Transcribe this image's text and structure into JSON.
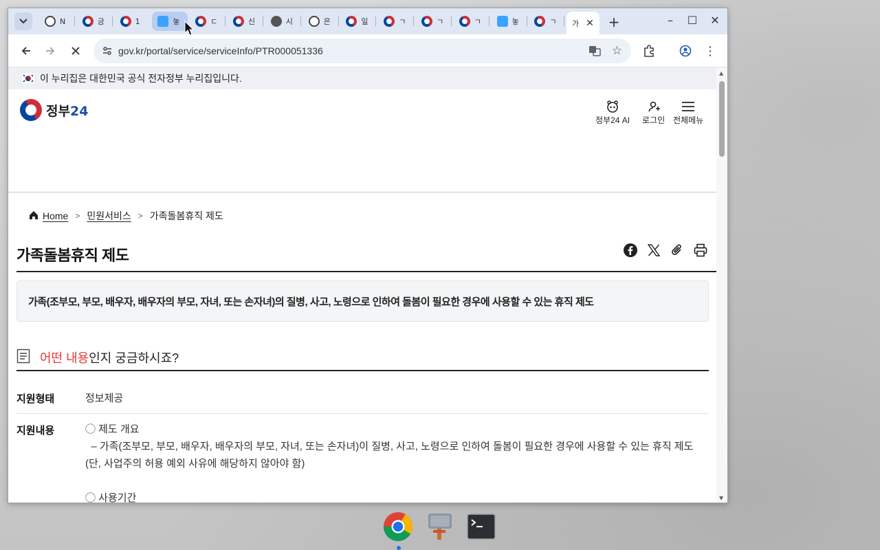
{
  "browser": {
    "tabs": [
      {
        "label": "N",
        "favicon": "gov-icon"
      },
      {
        "label": "긍",
        "favicon": "korea-logo-icon"
      },
      {
        "label": "1",
        "favicon": "korea-logo-icon"
      },
      {
        "label": "놓",
        "favicon": "document-icon"
      },
      {
        "label": "ㄷ",
        "favicon": "korea-logo-icon"
      },
      {
        "label": "신",
        "favicon": "korea-logo-icon"
      },
      {
        "label": "시",
        "favicon": "globe-icon"
      },
      {
        "label": "은",
        "favicon": "org-icon"
      },
      {
        "label": "일",
        "favicon": "korea-logo-icon"
      },
      {
        "label": "ㄱ",
        "favicon": "korea-logo-icon"
      },
      {
        "label": "ㄱ",
        "favicon": "korea-logo-icon"
      },
      {
        "label": "ㄱ",
        "favicon": "korea-logo-icon"
      },
      {
        "label": "놓",
        "favicon": "document-icon"
      },
      {
        "label": "ㄱ",
        "favicon": "korea-logo-icon"
      }
    ],
    "active_tab": {
      "label": "가"
    },
    "url": "gov.kr/portal/service/serviceInfo/PTR000051336"
  },
  "page": {
    "gov_banner": "이 누리집은 대한민국 공식 전자정부 누리집입니다.",
    "logo_text": "정부",
    "logo_num": "24",
    "header_icons": [
      {
        "label": "정부24 AI",
        "icon": "ai-icon"
      },
      {
        "label": "로그인",
        "icon": "user-icon"
      },
      {
        "label": "전체메뉴",
        "icon": "menu-icon"
      }
    ],
    "breadcrumb": [
      "Home",
      "민원서비스",
      "가족돌봄휴직 제도"
    ],
    "title": "가족돌봄휴직 제도",
    "summary": "가족(조부모, 부모, 배우자, 배우자의 부모, 자녀, 또는 손자녀)의 질병, 사고, 노령으로 인하여 돌봄이 필요한 경우에 사용할 수 있는 휴직 제도",
    "section_heading_red": "어떤 내용",
    "section_heading_rest": "인지 궁금하시죠?",
    "rows": [
      {
        "label": "지원형태",
        "lines": [
          "정보제공"
        ]
      },
      {
        "label": "지원내용",
        "lines": [
          "◯ 제도 개요",
          "  – 가족(조부모, 부모, 배우자, 배우자의 부모, 자녀, 또는 손자녀)이 질병, 사고, 노령으로 인하여 돌봄이 필요한 경우에 사용할 수 있는 휴직 제도",
          "(단, 사업주의 허용 예외 사유에 해당하지 않아야 함)",
          "",
          "◯ 사용기간"
        ]
      }
    ]
  },
  "taskbar": [
    "chrome-icon",
    "tools-icon",
    "terminal-icon"
  ],
  "colors": {
    "accent": "#1c4ea3",
    "red": "#e53935",
    "tabstrip": "#dfe7f5"
  }
}
